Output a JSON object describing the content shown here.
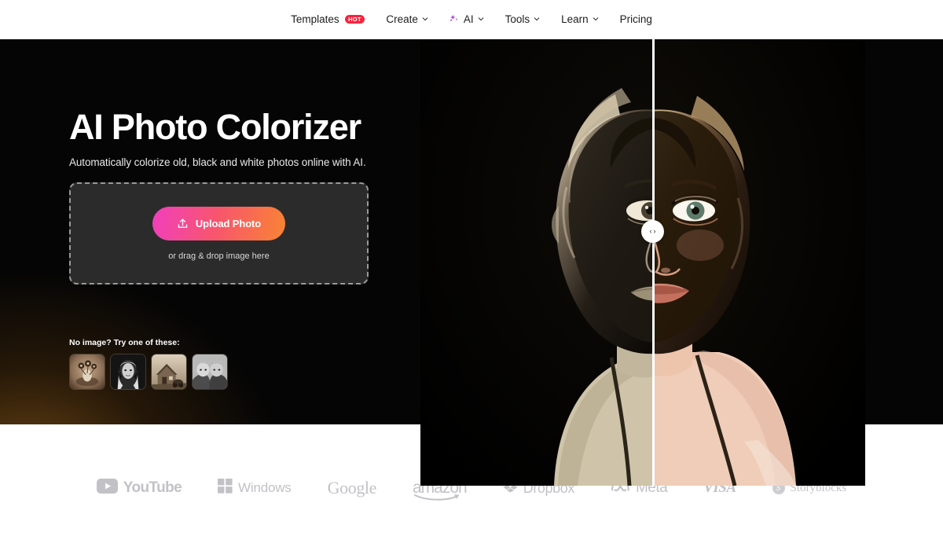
{
  "nav": {
    "items": [
      {
        "label": "Templates",
        "badge": "HOT",
        "caret": false,
        "spark": false
      },
      {
        "label": "Create",
        "caret": true,
        "spark": false
      },
      {
        "label": "AI",
        "caret": true,
        "spark": true
      },
      {
        "label": "Tools",
        "caret": true,
        "spark": false
      },
      {
        "label": "Learn",
        "caret": true,
        "spark": false
      },
      {
        "label": "Pricing",
        "caret": false,
        "spark": false
      }
    ]
  },
  "hero": {
    "title": "AI Photo Colorizer",
    "subtitle": "Automatically colorize old, black and white photos online with AI.",
    "upload_button": "Upload Photo",
    "drag_text": "or drag & drop image here",
    "samples_label": "No image? Try one of these:",
    "samples": [
      {
        "name": "sepia-flowers-vase"
      },
      {
        "name": "bw-elderly-woman-portrait"
      },
      {
        "name": "sepia-barn-farmhouse"
      },
      {
        "name": "bw-two-children"
      }
    ],
    "compare": {
      "before_label": "black and white original",
      "after_label": "colorized result",
      "handle_left_glyph": "‹",
      "handle_right_glyph": "›"
    }
  },
  "logos": [
    {
      "label": "YouTube",
      "icon": "youtube-icon"
    },
    {
      "label": "Windows",
      "icon": "windows-icon"
    },
    {
      "label": "Google",
      "icon": "google-wordmark"
    },
    {
      "label": "amazon",
      "icon": "amazon-wordmark"
    },
    {
      "label": "Dropbox",
      "icon": "dropbox-icon"
    },
    {
      "label": "Meta",
      "icon": "meta-icon"
    },
    {
      "label": "VISA",
      "icon": "visa-wordmark"
    },
    {
      "label": "Storyblocks",
      "icon": "storyblocks-icon"
    }
  ],
  "colors": {
    "hero_bg": "#050505",
    "accent_pink": "#f03fbd",
    "accent_orange": "#f98433",
    "hot_badge": "#f4253f",
    "ai_spark": "#a435f0",
    "logo_gray": "#6e6e78"
  }
}
